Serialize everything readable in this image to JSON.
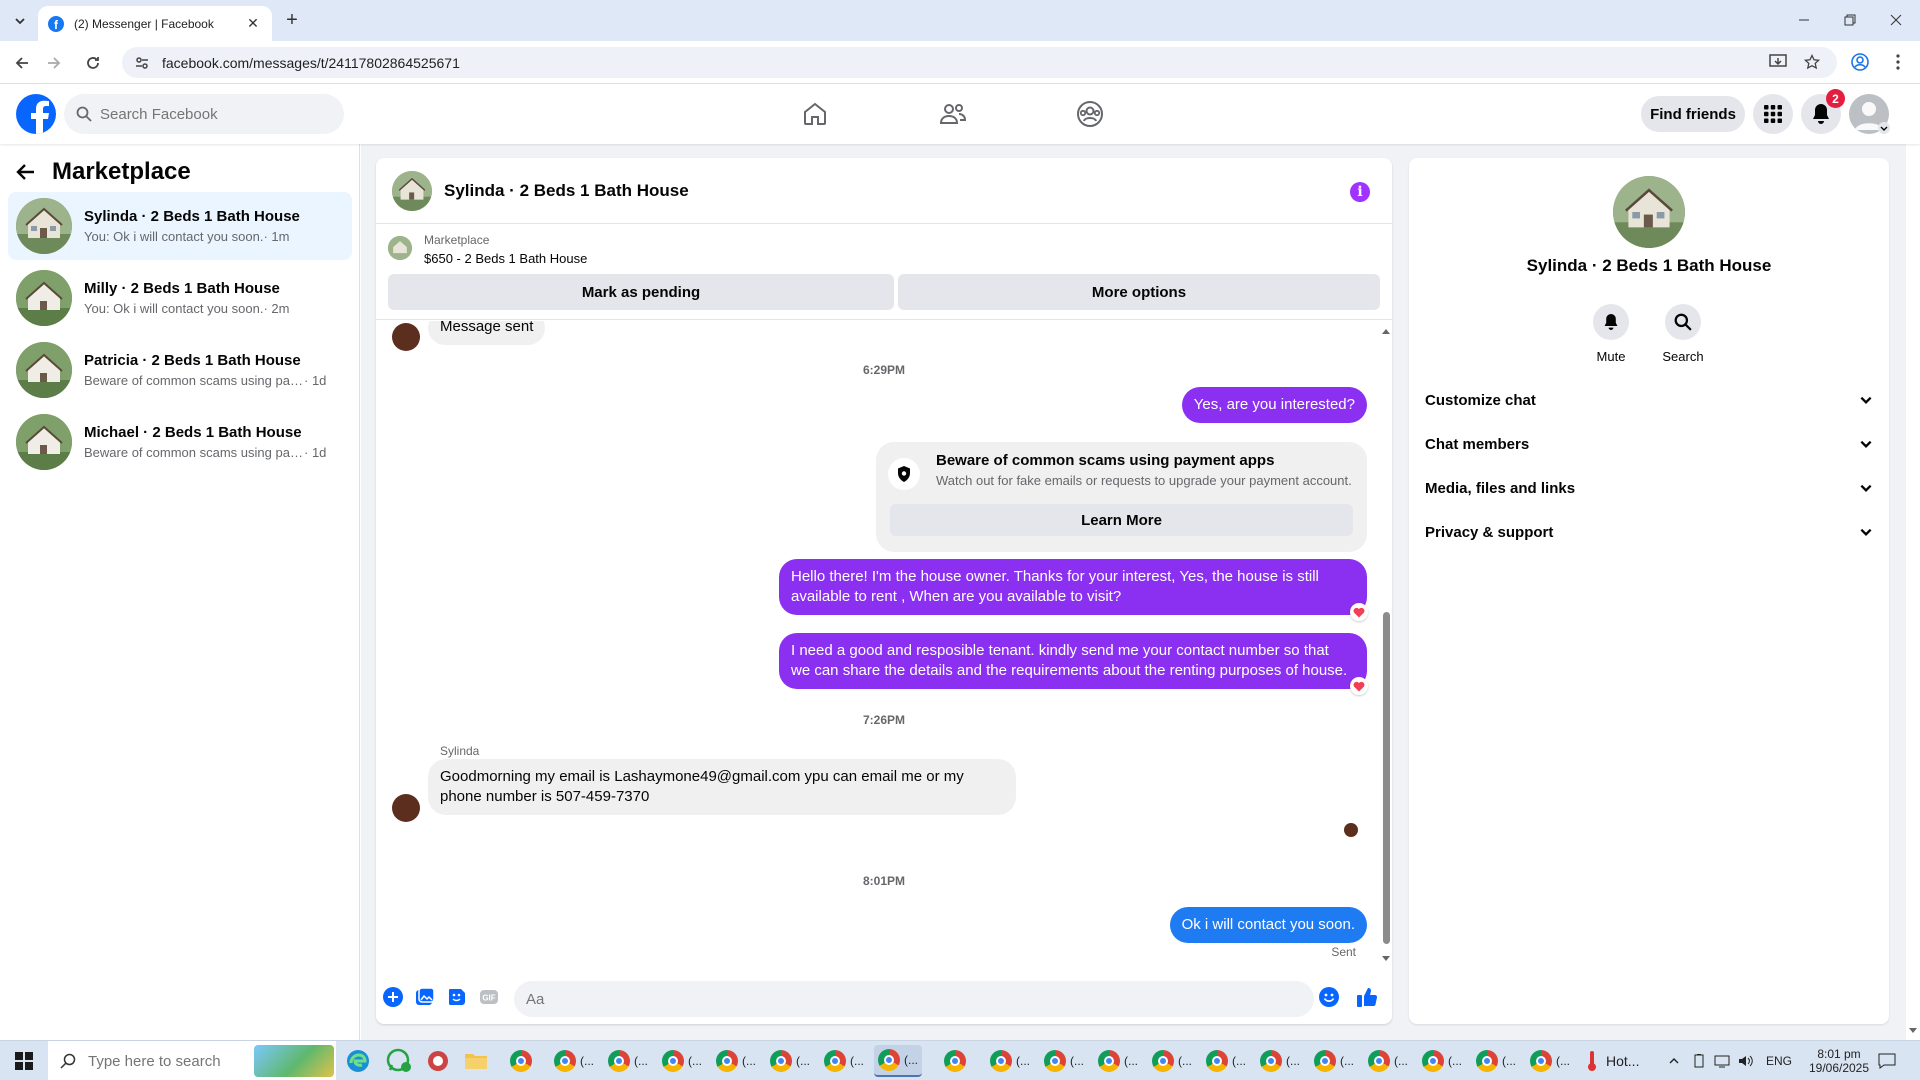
{
  "browser": {
    "tab_title": "(2) Messenger | Facebook",
    "url": "facebook.com/messages/t/24117802864525671"
  },
  "fb": {
    "search_placeholder": "Search Facebook",
    "find_friends": "Find friends",
    "notification_count": "2",
    "brand_color": "#0866ff"
  },
  "sidebar": {
    "title": "Marketplace",
    "conversations": [
      {
        "name": "Sylinda · 2 Beds 1 Bath House",
        "preview": "You: Ok i will contact you soon.",
        "time": "· 1m"
      },
      {
        "name": "Milly · 2 Beds 1 Bath House",
        "preview": "You: Ok i will contact you soon.",
        "time": "· 2m"
      },
      {
        "name": "Patricia · 2 Beds 1 Bath House",
        "preview": "Beware of common scams using pay...",
        "time": "· 1d"
      },
      {
        "name": "Michael · 2 Beds 1 Bath House",
        "preview": "Beware of common scams using pay...",
        "time": "· 1d"
      }
    ]
  },
  "chat": {
    "title": "Sylinda · 2 Beds 1 Bath House",
    "info_glyph": "i",
    "marketplace_label": "Marketplace",
    "listing": "$650 - 2 Beds 1 Bath House",
    "mark_pending": "Mark as pending",
    "more_options": "More options",
    "top_message": "Message sent",
    "time1": "6:29PM",
    "out1": "Yes, are you interested?",
    "warning_title": "Beware of common scams using payment apps",
    "warning_sub": "Watch out for fake emails or requests to upgrade your payment account.",
    "learn_more": "Learn More",
    "out2_line1": "Hello there! I'm the house owner. Thanks for your interest, Yes, the house is still",
    "out2_line2": "available to rent , When are you available to visit?",
    "out3_line1": "I need a good and resposible tenant.  kindly send me your contact number so that",
    "out3_line2": "we can share the details and the requirements about the renting purposes of house.",
    "time2": "7:26PM",
    "sender": "Sylinda",
    "in1_line1": "Goodmorning my email is Lashaymone49@gmail.com ypu can email me or my",
    "in1_line2": "phone number is 507-459-7370",
    "time3": "8:01PM",
    "out4": "Ok i will contact you soon.",
    "sent_label": "Sent",
    "input_placeholder": "Aa",
    "gif_label": "GIF",
    "bubble_color": "#8b2ff0",
    "last_bubble_color": "#1f7bf2"
  },
  "right_panel": {
    "name": "Sylinda · 2 Beds 1 Bath House",
    "mute": "Mute",
    "search": "Search",
    "sections": [
      "Customize chat",
      "Chat members",
      "Media, files and links",
      "Privacy & support"
    ]
  },
  "taskbar": {
    "search_placeholder": "Type here to search",
    "chrome_label": "(...",
    "weather": "Hot...",
    "lang": "ENG",
    "time": "8:01 pm",
    "date": "19/06/2025"
  }
}
